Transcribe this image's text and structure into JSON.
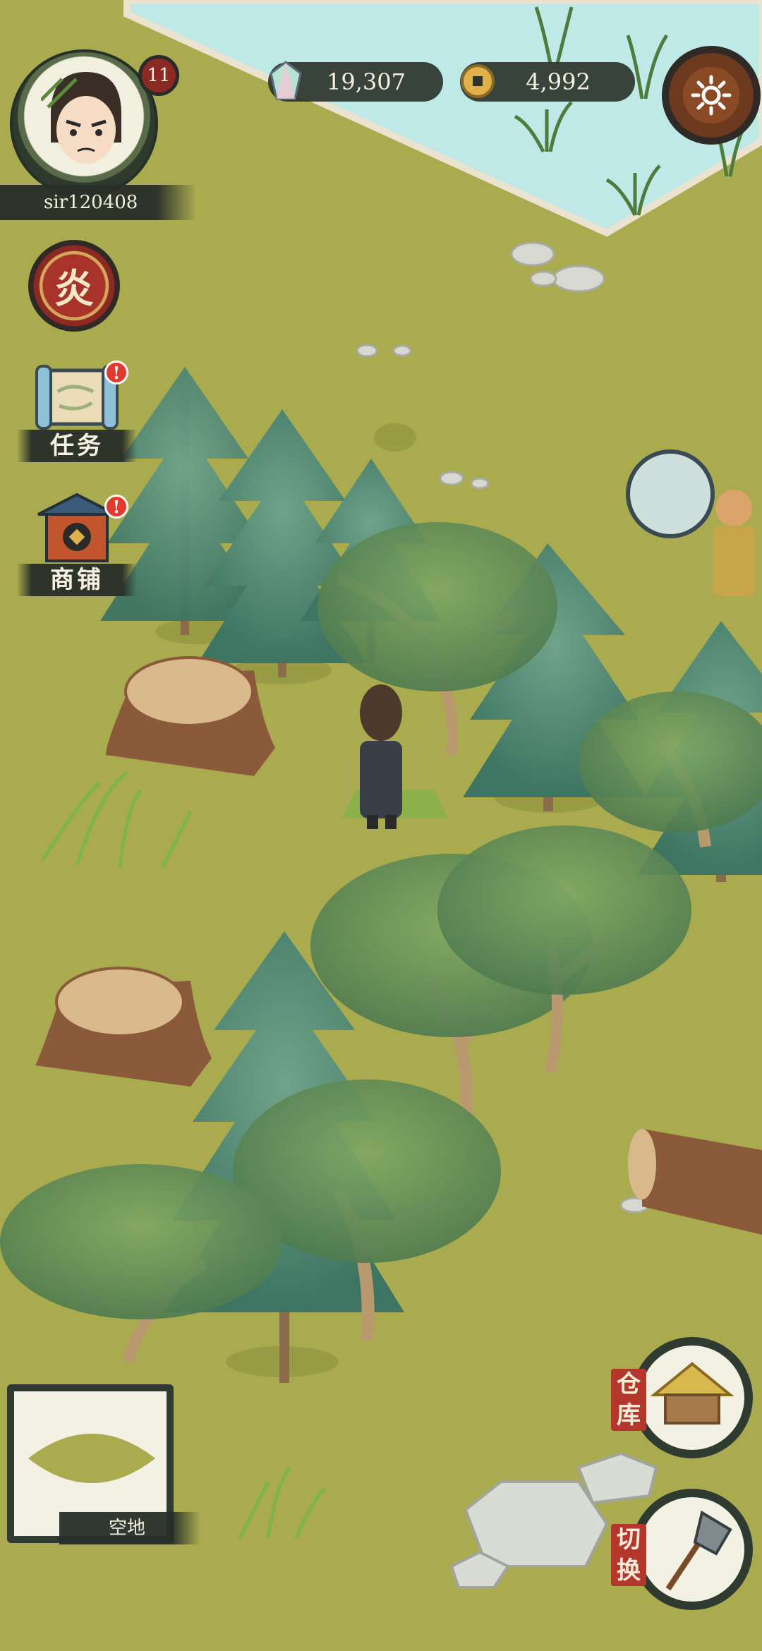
{
  "player": {
    "name": "sir120408",
    "level": "11"
  },
  "currencies": {
    "gems": "19,307",
    "coins": "4,992"
  },
  "seal": {
    "glyph": "炎"
  },
  "side_menu": [
    {
      "label": "任务",
      "badge": "!"
    },
    {
      "label": "商铺",
      "badge": "!"
    }
  ],
  "tile_info": {
    "label": "空地"
  },
  "actions": {
    "warehouse": "仓库",
    "switch": "切换"
  },
  "colors": {
    "grass": "#a9ab4e",
    "water": "#bfe9e6",
    "plate": "#2d342d",
    "seal_red": "#a8332b"
  },
  "icons": {
    "gem": "crystal-icon",
    "coin": "coin-icon",
    "settings": "sun-gear-icon",
    "tool": "axe-icon",
    "warehouse": "hut-icon"
  }
}
